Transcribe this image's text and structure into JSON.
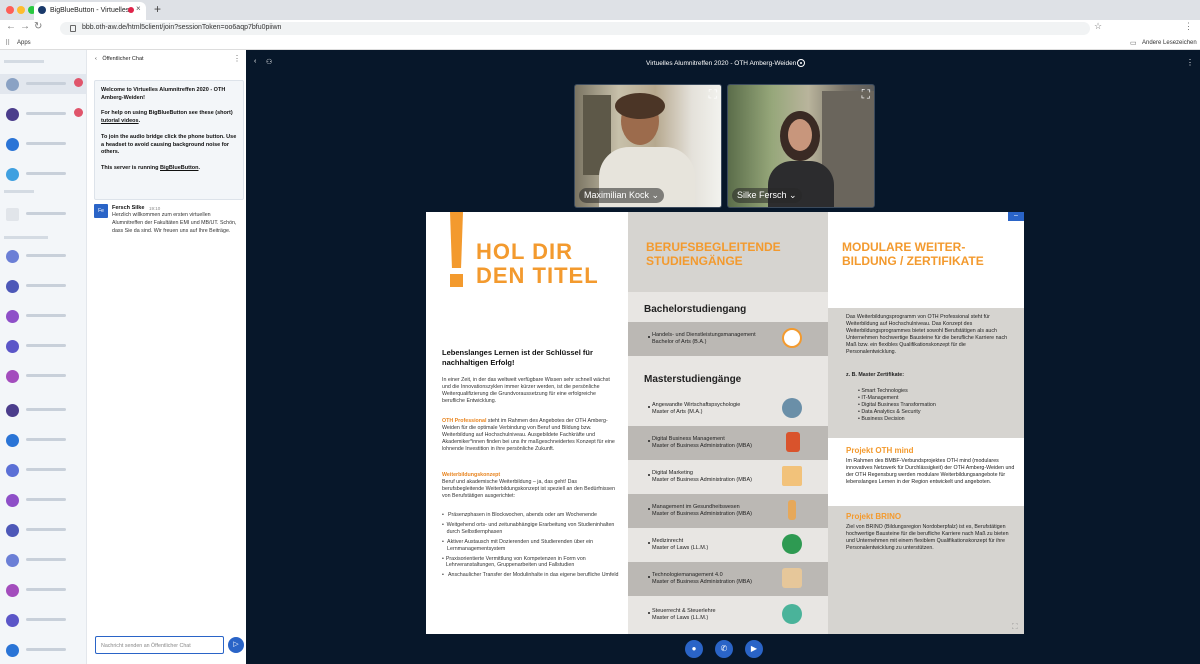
{
  "browser": {
    "tab_title": "BigBlueButton - Virtuelles",
    "tab_close": "×",
    "new_tab": "+",
    "url": "bbb.oth-aw.de/html5client/join?sessionToken=oo6aqp7bfu0piiwn",
    "apps_label": "Apps",
    "other_bookmarks": "Andere Lesezeichen"
  },
  "chat": {
    "header": "Öffentlicher Chat",
    "welcome": {
      "line1": "Welcome to Virtuelles Alumnitreffen 2020 - OTH Amberg-Weiden!",
      "line2_pre": "For help on using BigBlueButton see these (short) ",
      "line2_link": "tutorial videos",
      "line2_post": ".",
      "line3": "To join the audio bridge click the phone button. Use a headset to avoid causing background noise for others.",
      "line4_pre": "This server is running ",
      "line4_link": "BigBlueButton",
      "line4_post": "."
    },
    "message": {
      "avatar": "Fe",
      "sender": "Fersch Silke",
      "time": "19:10",
      "text": "Herzlich willkommen zum ersten virtuellen Alumnitreffen der Fakultäten EMI und MB/UT. Schön, dass Sie da sind. Wir freuen uns auf Ihre Beiträge."
    },
    "input_placeholder": "Nachricht senden an Öffentlicher Chat",
    "send_icon": "▷"
  },
  "meeting": {
    "title": "Virtuelles Alumnitreffen 2020 - OTH Amberg-Weiden",
    "videos": [
      {
        "name": "Maximilian Kock ⌄"
      },
      {
        "name": "Silke Fersch ⌄"
      }
    ]
  },
  "slide": {
    "col1": {
      "title_line1": "HOL DIR",
      "title_line2": "DEN TITEL",
      "lead": "Lebenslanges Lernen ist der Schlüssel für nachhaltigen Erfolg!",
      "p1": "In einer Zeit, in der das weltweit verfügbare Wissen sehr schnell wächst und die Innovationszyklen immer kürzer werden, ist die persönliche Weiterqualifizierung die Grund­voraussetzung für eine erfolgreiche berufliche Entwicklung.",
      "p2_org": "OTH Professional",
      "p2_rest": " steht im Rahmen des Angebotes der OTH Amberg-Weiden für die optimale Verbindung von Beruf und Bildung bzw. Weiterbildung auf Hochschulniveau. Ausgebildete Fachkräfte und Akademiker*innen finden bei uns ihr maßgeschneidertes Konzept für eine lohnende Investition in ihre persönliche Zukunft.",
      "p3_head": "Weiterbildungskonzept",
      "p3": "Beruf und akademische Weiterbildung – ja, das geht! Das berufsbegleitende Weiterbildungskonzept ist speziell an den Bedürfnissen von Berufstätigen ausgerichtet:",
      "bullets": [
        "Präsenzphasen in Blockwochen, abends oder am Wochenende",
        "Weitgehend orts- und zeitunabhängige Erarbeitung von Studieninhalten durch Selbstlernphasen",
        "Aktiver Austausch mit Dozierenden und Studierenden über ein Lernmanagementsystem",
        "Praxisorientierte Vermittlung von Kompetenzen in Form von Lehrveranstaltungen, Gruppenarbeiten und Fallstudien",
        "Anschaulicher Transfer der Modulinhalte in das eigene berufliche Umfeld"
      ]
    },
    "col2": {
      "title_line1": "BERUFSBEGLEITENDE",
      "title_line2": "STUDIENGÄNGE",
      "bachelor_head": "Bachelorstudiengang",
      "master_head": "Masterstudiengänge",
      "programs": [
        {
          "line1": "Handels- und Dienstleistungsmanagement",
          "line2": "Bachelor of Arts (B.A.)"
        },
        {
          "line1": "Angewandte Wirtschaftspsychologie",
          "line2": "Master of Arts (M.A.)"
        },
        {
          "line1": "Digital Business Management",
          "line2": "Master of Business Administration (MBA)"
        },
        {
          "line1": "Digital Marketing",
          "line2": "Master of Business Administration (MBA)"
        },
        {
          "line1": "Management im Gesundheitswesen",
          "line2": "Master of Business Administration (MBA)"
        },
        {
          "line1": "Medizinrecht",
          "line2": "Master of Laws (LL.M.)"
        },
        {
          "line1": "Technologiemanagement 4.0",
          "line2": "Master of Business Administration (MBA)"
        },
        {
          "line1": "Steuerrecht & Steuerlehre",
          "line2": "Master of Laws (LL.M.)"
        }
      ]
    },
    "col3": {
      "title_line1": "MODULARE WEITER-",
      "title_line2": "BILDUNG / ZERTIFIKATE",
      "intro": "Das Weiterbildungsprogramm von OTH Professional steht für Weiterbildung auf Hochschulniveau. Das Konzept des Weiterbildungsprogrammes bietet sowohl Berufstätigen als auch Unternehmen hochwertige Bausteine für die berufliche Karriere nach Maß bzw. ein flexibles Qualifikationskonzept für die Personalentwicklung.",
      "cert_head": "z. B. Master Zertifikate:",
      "certs": [
        "Smart Technologies",
        "IT-Management",
        "Digital Business Transformation",
        "Data Analytics & Security",
        "Business Decision"
      ],
      "mind_head": "Projekt OTH mind",
      "mind_text": "Im Rahmen des BMBF-Verbundsprojektes OTH mind (modulares innovatives Netzwerk für Durchlässigkeit) der OTH Amberg-Weiden und der OTH Regensburg werden modulare Weiterbildungsangebote für lebenslanges Lernen in der Region entwickelt und angeboten.",
      "brino_head": "Projekt BRINO",
      "brino_text": "Ziel von BRINO (Bildungsregion Nordoberpfalz) ist es, Berufstätigen hochwertige Bausteine für die berufliche Karriere nach Maß zu bieten und Unternehmen mit einem flexiblem Qualifikationskonzept für ihre Personalentwicklung zu unterstützen."
    }
  },
  "colors": {
    "accent": "#f39a2e",
    "primary": "#2a64c7",
    "bg": "#07172a"
  },
  "icons": [
    "globe-icon",
    "tree-icon",
    "phone-icon",
    "chart-icon",
    "caduceus-icon",
    "paragraph-icon",
    "plant-icon"
  ]
}
